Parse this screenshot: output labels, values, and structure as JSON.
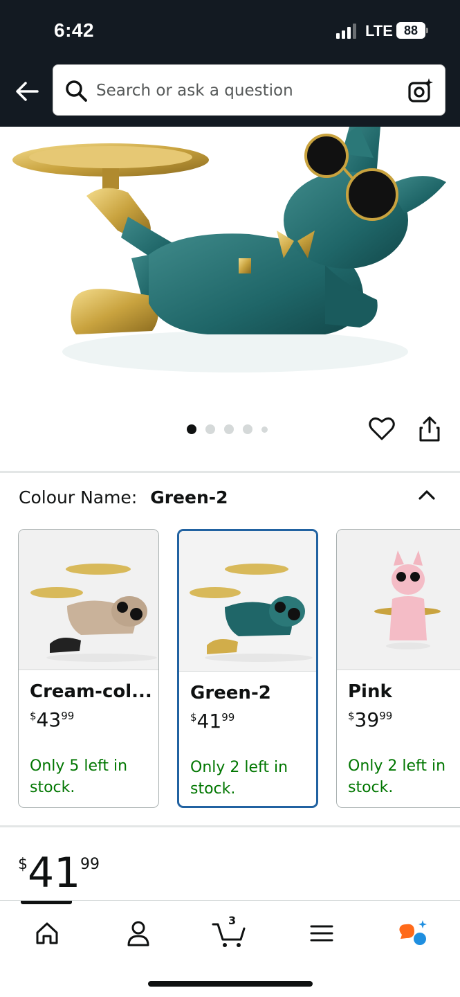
{
  "status_bar": {
    "time": "6:42",
    "network": "LTE",
    "battery": "88"
  },
  "header": {
    "search_placeholder": "Search or ask a question",
    "back_icon": "arrow-left-icon",
    "camera_icon": "camera-lens-icon"
  },
  "gallery": {
    "image_count": 5,
    "active_index": 0
  },
  "colour": {
    "label": "Colour Name:",
    "selected": "Green-2",
    "options": [
      {
        "name": "Cream-col...",
        "currency": "$",
        "price_whole": "43",
        "price_fraction": "99",
        "stock": "Only 5 left in stock.",
        "selected": false
      },
      {
        "name": "Green-2",
        "currency": "$",
        "price_whole": "41",
        "price_fraction": "99",
        "stock": "Only 2 left in stock.",
        "selected": true
      },
      {
        "name": "Pink",
        "currency": "$",
        "price_whole": "39",
        "price_fraction": "99",
        "stock": "Only 2 left in stock.",
        "selected": false
      }
    ]
  },
  "price": {
    "currency": "$",
    "whole": "41",
    "fraction": "99"
  },
  "bottom_nav": {
    "cart_count": "3",
    "items": [
      "home-icon",
      "account-icon",
      "cart-icon",
      "menu-icon",
      "rufus-assistant-icon"
    ]
  },
  "colors": {
    "header_bg": "#131a22",
    "stock_green": "#007600",
    "selected_border": "#2162a1"
  }
}
